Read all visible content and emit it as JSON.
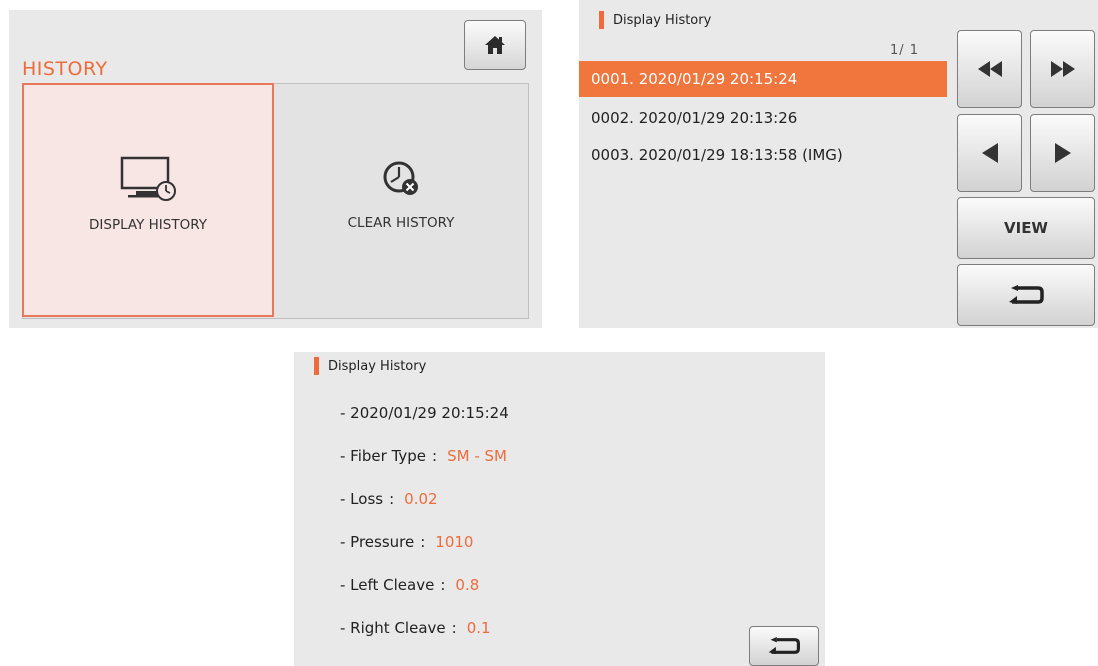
{
  "menu": {
    "title": "HISTORY",
    "items": [
      {
        "label": "DISPLAY HISTORY",
        "icon": "monitor-clock-icon"
      },
      {
        "label": "CLEAR HISTORY",
        "icon": "clock-clear-icon"
      }
    ],
    "home_icon": "home-icon"
  },
  "list": {
    "header": "Display History",
    "page": "1/  1",
    "rows": [
      "0001. 2020/01/29  20:15:24",
      "0002. 2020/01/29  20:13:26",
      "0003. 2020/01/29  18:13:58 (IMG)"
    ],
    "view_label": "VIEW"
  },
  "detail": {
    "header": "Display History",
    "timestamp": "- 2020/01/29 20:15:24",
    "fields": [
      {
        "label": "- Fiber Type",
        "value": "SM - SM"
      },
      {
        "label": "- Loss",
        "value": "0.02"
      },
      {
        "label": "- Pressure",
        "value": "1010"
      },
      {
        "label": "- Left Cleave",
        "value": "0.8"
      },
      {
        "label": "- Right Cleave",
        "value": "0.1"
      }
    ],
    "separator": ":"
  },
  "colors": {
    "accent": "#ee6c3b",
    "selected_row": "#f0763d",
    "panel_bg": "#e9e9e9"
  }
}
